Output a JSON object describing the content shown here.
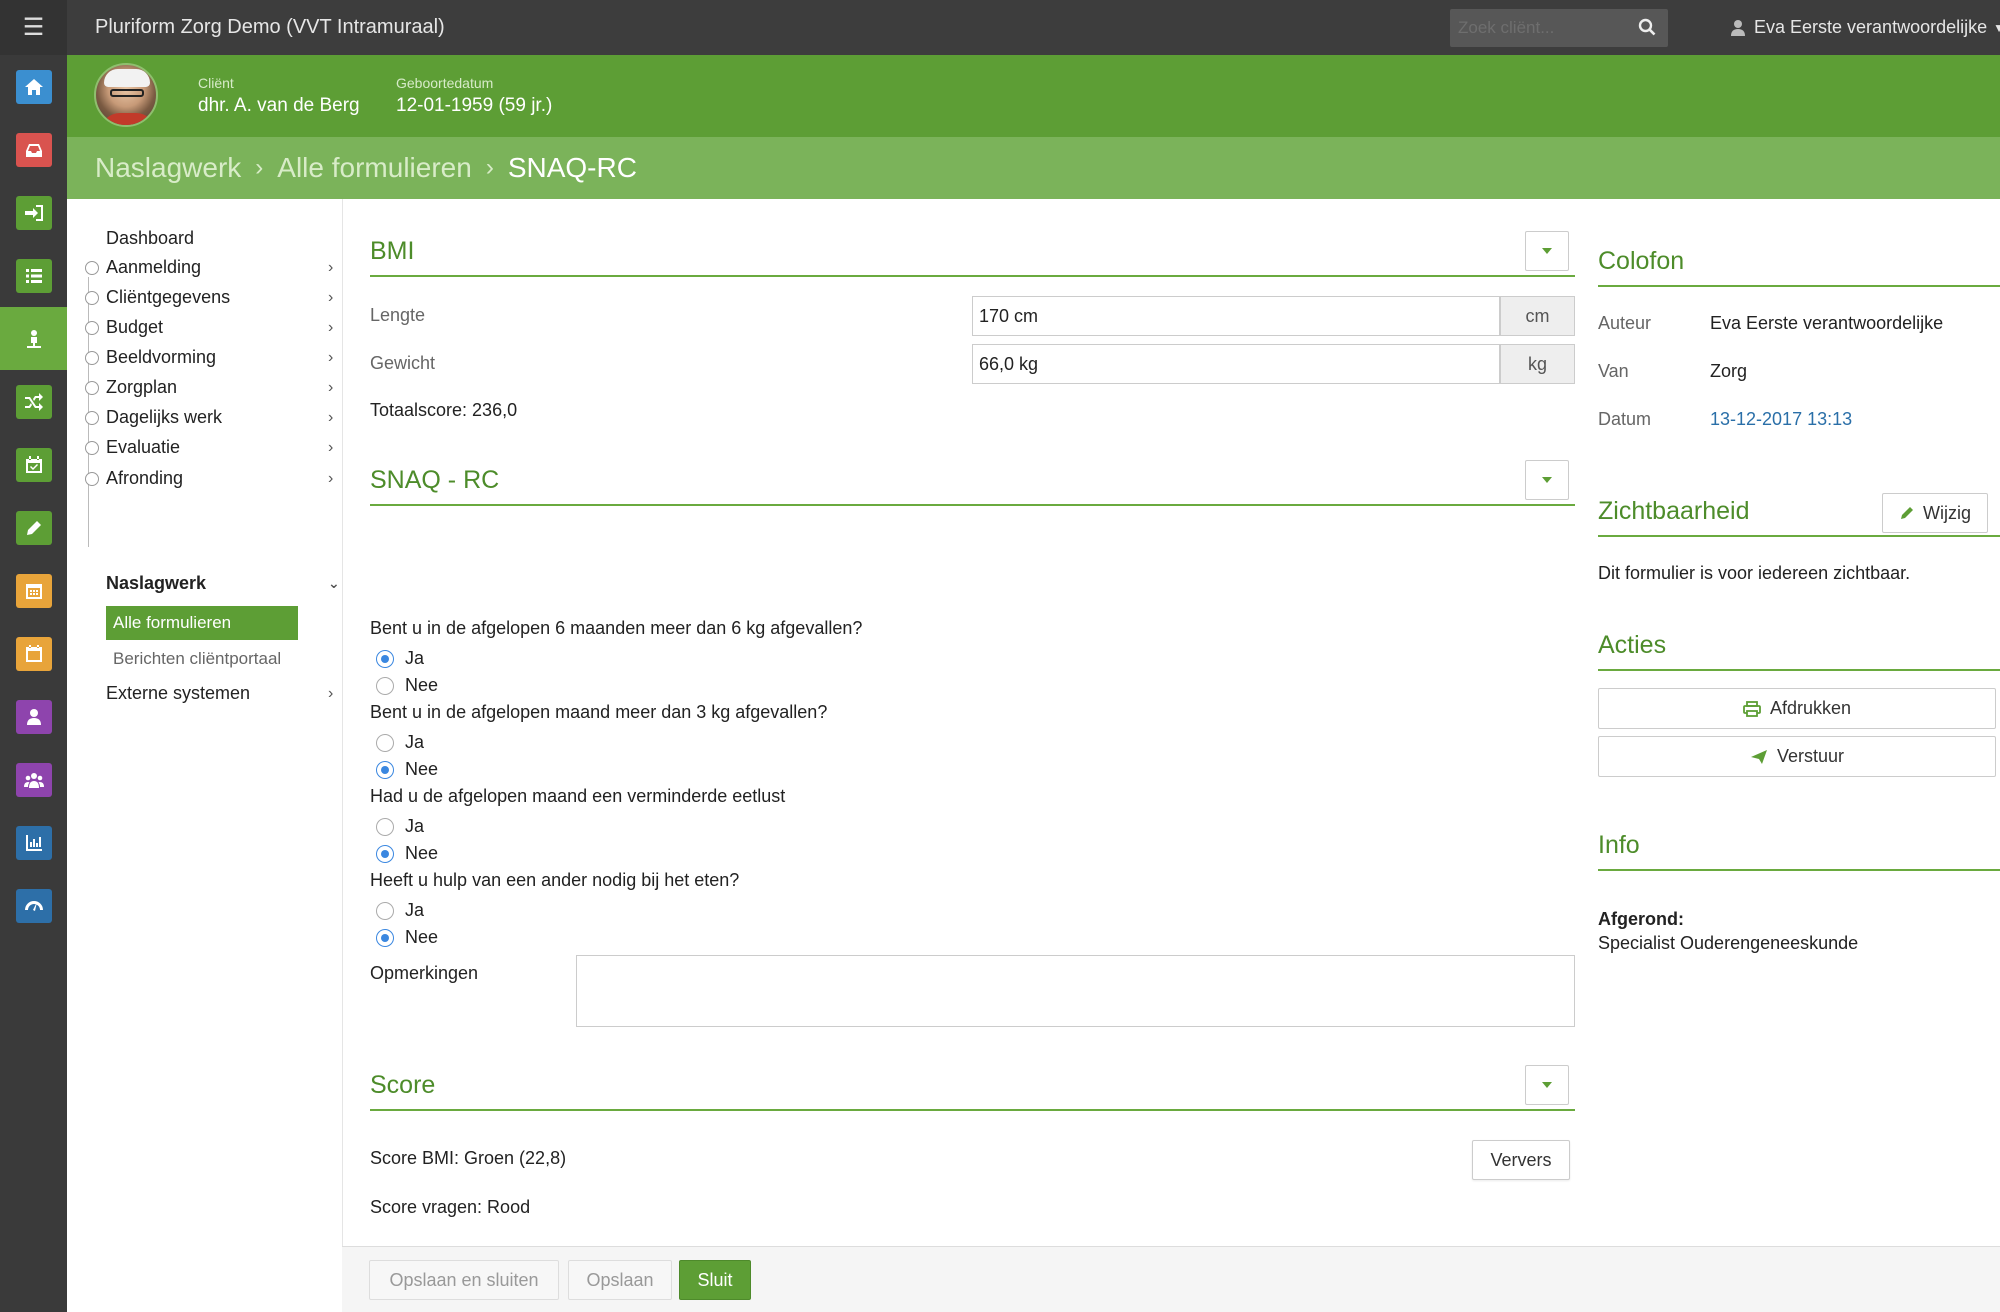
{
  "app": {
    "title": "Pluriform Zorg Demo  (VVT Intramuraal)",
    "search_placeholder": "Zoek cliënt...",
    "user": "Eva Eerste verantwoordelijke"
  },
  "iconbar": [
    {
      "name": "home-icon",
      "color": "#3b8fd0"
    },
    {
      "name": "inbox-icon",
      "color": "#d9534f"
    },
    {
      "name": "sign-in-icon",
      "color": "#5d9e35"
    },
    {
      "name": "list-icon",
      "color": "#5d9e35"
    },
    {
      "name": "client-icon",
      "color": "#5d9e35",
      "active": true
    },
    {
      "name": "shuffle-icon",
      "color": "#5d9e35"
    },
    {
      "name": "calendar-check-icon",
      "color": "#5d9e35"
    },
    {
      "name": "pencil-icon",
      "color": "#5d9e35"
    },
    {
      "name": "calendar-grid-icon",
      "color": "#e8a43a"
    },
    {
      "name": "calendar-icon",
      "color": "#e8a43a"
    },
    {
      "name": "user-icon",
      "color": "#8e44ad"
    },
    {
      "name": "users-icon",
      "color": "#8e44ad"
    },
    {
      "name": "bar-chart-icon",
      "color": "#2d6fa8"
    },
    {
      "name": "dashboard-icon",
      "color": "#2d6fa8"
    }
  ],
  "patient": {
    "client_label": "Cliënt",
    "client_name": "dhr. A. van de Berg",
    "dob_label": "Geboortedatum",
    "dob": "12-01-1959 (59 jr.)"
  },
  "breadcrumb": {
    "items": [
      "Naslagwerk",
      "Alle formulieren"
    ],
    "current": "SNAQ-RC"
  },
  "nav": {
    "dashboard": "Dashboard",
    "items": [
      "Aanmelding",
      "Cliëntgegevens",
      "Budget",
      "Beeldvorming",
      "Zorgplan",
      "Dagelijks werk",
      "Evaluatie",
      "Afronding"
    ],
    "section": "Naslagwerk",
    "sub_active": "Alle formulieren",
    "sub_other": "Berichten cliëntportaal",
    "external": "Externe systemen"
  },
  "bmi": {
    "title": "BMI",
    "length_label": "Lengte",
    "length_value": "170 cm",
    "length_unit": "cm",
    "weight_label": "Gewicht",
    "weight_value": "66,0 kg",
    "weight_unit": "kg",
    "total": "Totaalscore: 236,0"
  },
  "snaq": {
    "title": "SNAQ - RC",
    "yes": "Ja",
    "no": "Nee",
    "questions": [
      {
        "text": "Bent u in de afgelopen 6 maanden meer dan 6 kg afgevallen?",
        "answer": "Ja"
      },
      {
        "text": "Bent u in de afgelopen maand meer dan 3 kg afgevallen?",
        "answer": "Nee"
      },
      {
        "text": "Had u de afgelopen maand een verminderde eetlust",
        "answer": "Nee"
      },
      {
        "text": "Heeft u hulp van een ander nodig bij het eten?",
        "answer": "Nee"
      }
    ],
    "remarks_label": "Opmerkingen",
    "remarks_value": ""
  },
  "score": {
    "title": "Score",
    "bmi": "Score BMI: Groen (22,8)",
    "questions": "Score vragen: Rood",
    "refresh": "Ververs"
  },
  "footer": {
    "save_close": "Opslaan en sluiten",
    "save": "Opslaan",
    "close": "Sluit"
  },
  "colofon": {
    "title": "Colofon",
    "author_label": "Auteur",
    "author": "Eva Eerste verantwoordelijke",
    "from_label": "Van",
    "from": "Zorg",
    "date_label": "Datum",
    "date": "13-12-2017 13:13"
  },
  "visibility": {
    "title": "Zichtbaarheid",
    "edit": "Wijzig",
    "text": "Dit formulier is voor iedereen zichtbaar."
  },
  "actions": {
    "title": "Acties",
    "print": "Afdrukken",
    "send": "Verstuur"
  },
  "info": {
    "title": "Info",
    "label": "Afgerond:",
    "value": "Specialist Ouderengeneeskunde"
  },
  "colors": {
    "green": "#5d9e35",
    "light_green": "#7bb35a",
    "heading_green": "#4d8c2a",
    "radio_blue": "#3a87e0"
  }
}
